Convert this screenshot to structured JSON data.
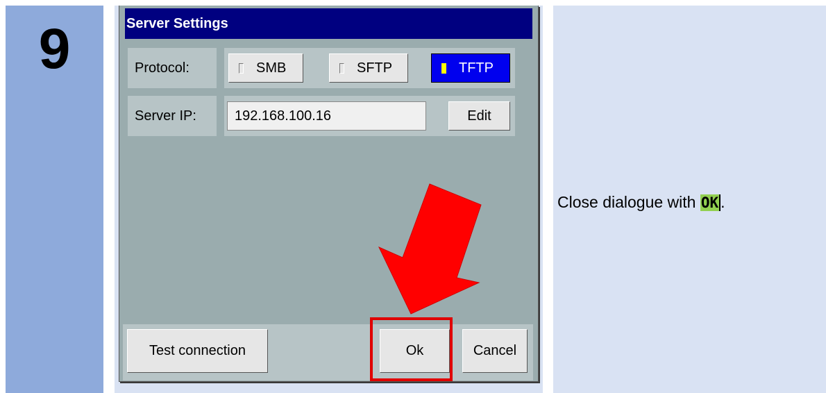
{
  "step": {
    "number": "9"
  },
  "dialog": {
    "title": "Server Settings",
    "protocol": {
      "label": "Protocol:",
      "options": [
        "SMB",
        "SFTP",
        "TFTP"
      ],
      "selected": "TFTP"
    },
    "server_ip": {
      "label": "Server IP:",
      "value": "192.168.100.16",
      "edit_label": "Edit"
    },
    "buttons": {
      "test_connection": "Test connection",
      "ok": "Ok",
      "cancel": "Cancel"
    }
  },
  "instruction": {
    "text_before": "Close dialogue with ",
    "highlight": "OK",
    "text_after": "."
  },
  "colors": {
    "step_column": "#8eaadb",
    "content_column": "#d9e2f3",
    "title_bar": "#000080",
    "selected_option": "#0000ee",
    "arrow": "#ff0000",
    "highlight": "#92d050"
  }
}
